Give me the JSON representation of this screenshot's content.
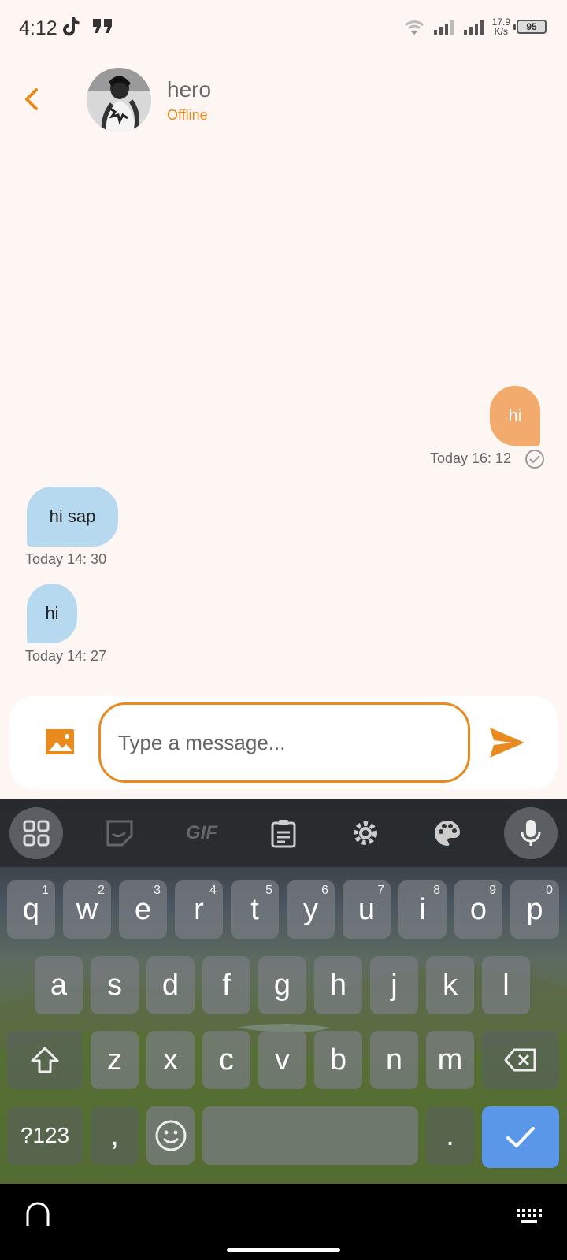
{
  "status_bar": {
    "time": "4:12",
    "net_speed_value": "17.9",
    "net_speed_unit": "K/s",
    "battery": "95"
  },
  "header": {
    "contact_name": "hero",
    "contact_status": "Offline",
    "accent_color": "#e98a1f"
  },
  "messages": [
    {
      "direction": "outgoing",
      "text": "hi",
      "timestamp": "Today 16: 12",
      "status": "read-check-icon"
    },
    {
      "direction": "incoming",
      "text": "hi sap",
      "timestamp": "Today 14: 30"
    },
    {
      "direction": "incoming",
      "text": "hi",
      "timestamp": "Today 14: 27"
    }
  ],
  "composer": {
    "placeholder": "Type a message...",
    "gallery_icon": "image-icon",
    "send_icon": "send-icon"
  },
  "keyboard": {
    "toolbar": [
      "apps-grid-icon",
      "sticker-icon",
      "gif-icon",
      "clipboard-icon",
      "settings-gear-icon",
      "palette-icon",
      "microphone-icon"
    ],
    "gif_label": "GIF",
    "row1": [
      "q",
      "w",
      "e",
      "r",
      "t",
      "y",
      "u",
      "i",
      "o",
      "p"
    ],
    "row1_hints": [
      "1",
      "2",
      "3",
      "4",
      "5",
      "6",
      "7",
      "8",
      "9",
      "0"
    ],
    "row2": [
      "a",
      "s",
      "d",
      "f",
      "g",
      "h",
      "j",
      "k",
      "l"
    ],
    "row3": [
      "z",
      "x",
      "c",
      "v",
      "b",
      "n",
      "m"
    ],
    "symbols_label": "?123",
    "comma": ",",
    "period": "."
  }
}
